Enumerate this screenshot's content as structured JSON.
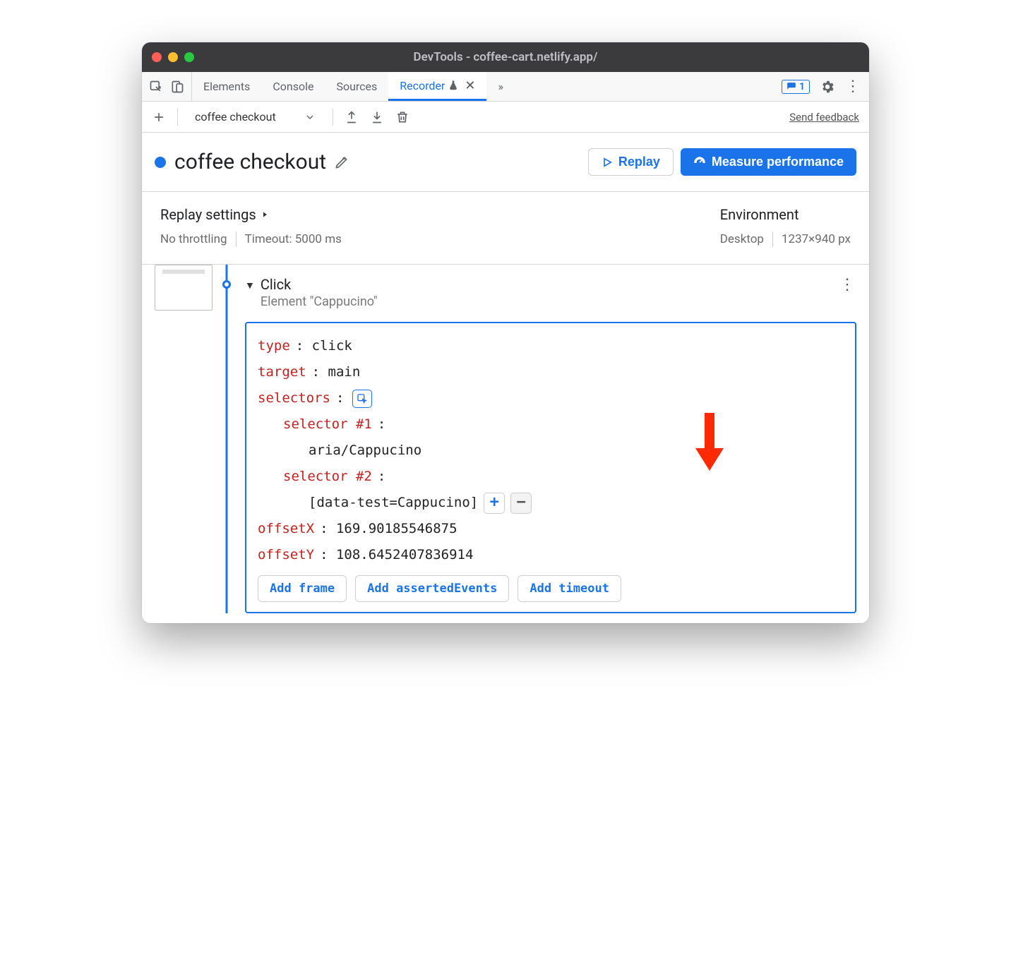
{
  "window": {
    "title": "DevTools - coffee-cart.netlify.app/"
  },
  "tabs": {
    "elements": "Elements",
    "console": "Console",
    "sources": "Sources",
    "recorder": "Recorder"
  },
  "issues_badge": "1",
  "rec_toolbar": {
    "recording_name": "coffee checkout",
    "feedback": "Send feedback"
  },
  "header": {
    "title": "coffee checkout",
    "replay": "Replay",
    "measure": "Measure performance"
  },
  "settings": {
    "replay_heading": "Replay settings",
    "throttling": "No throttling",
    "timeout": "Timeout: 5000 ms",
    "env_heading": "Environment",
    "device": "Desktop",
    "viewport": "1237×940 px"
  },
  "step": {
    "title": "Click",
    "subtitle": "Element \"Cappucino\"",
    "type_k": "type",
    "type_v": ": click",
    "target_k": "target",
    "target_v": ": main",
    "selectors_k": "selectors",
    "selectors_v": ":",
    "sel1_k": "selector #1",
    "sel1_v": ":",
    "sel1_val": "aria/Cappucino",
    "sel2_k": "selector #2",
    "sel2_v": ":",
    "sel2_val": "[data-test=Cappucino]",
    "offx_k": "offsetX",
    "offx_v": ": 169.90185546875",
    "offy_k": "offsetY",
    "offy_v": ": 108.6452407836914",
    "add_frame": "Add frame",
    "add_asserted": "Add assertedEvents",
    "add_timeout": "Add timeout"
  }
}
